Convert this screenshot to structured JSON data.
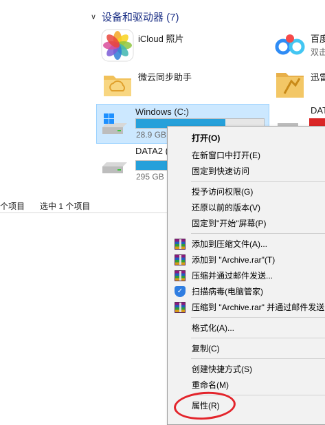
{
  "explorer": {
    "group_title": "设备和驱动器 (7)",
    "icloud_label": "iCloud 照片",
    "baidu_label": "百度",
    "baidu_sub": "双击",
    "weiyun_label": "微云同步助手",
    "xunlei_label": "迅雷",
    "drive_c_label": "Windows (C:)",
    "drive_c_free": "28.9 GB",
    "drive_c_used_fraction": 0.7,
    "data_label": "DAT",
    "data2_label": "DATA2 (",
    "data2_free": "295 GB",
    "data2_used_fraction": 0.18,
    "status_items": "个项目",
    "status_selected": "选中 1 个项目"
  },
  "menu": {
    "open": "打开(O)",
    "open_new": "在新窗口中打开(E)",
    "pin_quick": "固定到快速访问",
    "grant": "授予访问权限(G)",
    "restore": "还原以前的版本(V)",
    "pin_start": "固定到\"开始\"屏幕(P)",
    "add_archive": "添加到压缩文件(A)...",
    "add_rar": "添加到 \"Archive.rar\"(T)",
    "compress_email": "压缩并通过邮件发送...",
    "scan": "扫描病毒(电脑管家)",
    "compress_rar_email": "压缩到 \"Archive.rar\" 并通过邮件发送",
    "format": "格式化(A)...",
    "copy": "复制(C)",
    "shortcut": "创建快捷方式(S)",
    "rename": "重命名(M)",
    "properties": "属性(R)"
  },
  "colors": {
    "header": "#1e3287",
    "selection": "#cce8ff",
    "bar_fill": "#26a0da",
    "annotation": "#e3242b"
  }
}
